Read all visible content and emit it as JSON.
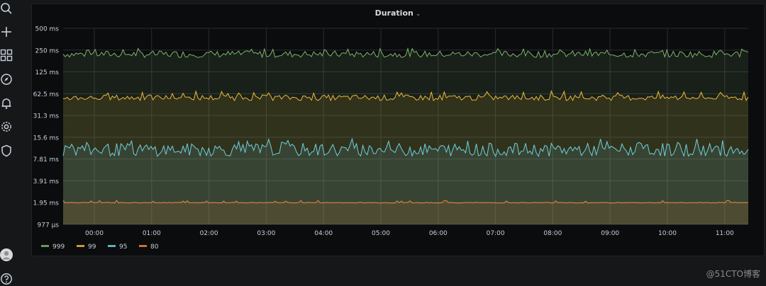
{
  "nav": {
    "icons": [
      "search-icon",
      "plus-icon",
      "dashboards-icon",
      "explore-icon",
      "alerting-icon",
      "settings-icon",
      "shield-icon",
      "avatar",
      "help-icon"
    ]
  },
  "panel": {
    "title": "Duration",
    "caret": "⌄"
  },
  "chart_data": {
    "type": "line",
    "title": "Duration",
    "scale": "log2",
    "y_ticks": [
      "500 ms",
      "250 ms",
      "125 ms",
      "62.5 ms",
      "31.3 ms",
      "15.6 ms",
      "7.81 ms",
      "3.91 ms",
      "1.95 ms",
      "977 µs"
    ],
    "ylim_ms": [
      0.977,
      500
    ],
    "x_ticks": [
      "00:00",
      "01:00",
      "02:00",
      "03:00",
      "04:00",
      "05:00",
      "06:00",
      "07:00",
      "08:00",
      "09:00",
      "10:00",
      "11:00"
    ],
    "grid": true,
    "fill": true,
    "legend_position": "bottom-left",
    "series": [
      {
        "name": "999",
        "color": "#7eb26d",
        "level_ms": 220,
        "jitter": 0.18,
        "spike_ms": 265
      },
      {
        "name": "99",
        "color": "#eab839",
        "level_ms": 55,
        "jitter": 0.15,
        "spike_ms": 68
      },
      {
        "name": "95",
        "color": "#6ed0e0",
        "level_ms": 10.5,
        "jitter": 0.35,
        "spike_ms": 15
      },
      {
        "name": "80",
        "color": "#ef843c",
        "level_ms": 1.95,
        "jitter": 0.02,
        "spike_ms": 2.1
      }
    ]
  },
  "watermark": "@51CTO博客"
}
